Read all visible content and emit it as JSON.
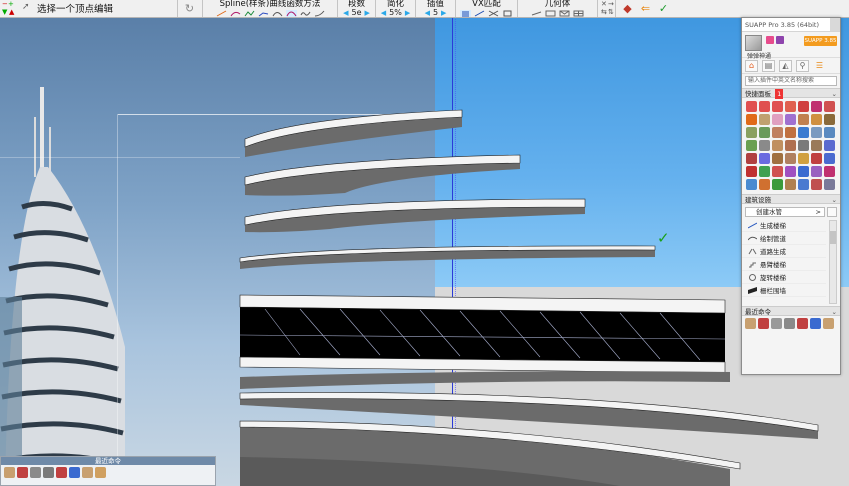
{
  "toolbar": {
    "status_hint": "选择一个顶点编辑",
    "spline_label": "Spline(样条)曲线函数方法",
    "segments_label": "段数",
    "segments_value": "5e",
    "simplify_label": "简化",
    "simplify_value": "5%",
    "interpolate_label": "插值",
    "interpolate_value": "5",
    "vx_label": "VX匹配",
    "geometry_label": "几何体"
  },
  "suapp": {
    "title": "SUAPP Pro 3.85 (64bit)",
    "username": "弹弹神通",
    "pro_button": "SUAPP 3.85",
    "search_placeholder": "输入插件中英文名称搜索",
    "quick_panel_label": "快捷面板",
    "quick_panel_badge": "1",
    "building_section_label": "建筑设施",
    "dropdown_value": "创建水管",
    "list_items": [
      {
        "label": "生成楼梯",
        "icon": "stair-icon"
      },
      {
        "label": "绘制管道",
        "icon": "pipe-icon"
      },
      {
        "label": "道路生成",
        "icon": "road-icon"
      },
      {
        "label": "悬臂楼梯",
        "icon": "cantilever-stair-icon"
      },
      {
        "label": "旋转楼梯",
        "icon": "spiral-stair-icon"
      },
      {
        "label": "栅栏围墙",
        "icon": "fence-icon"
      }
    ],
    "recent_label": "最近命令"
  },
  "mini_panel": {
    "label": "最近命令"
  },
  "colors": {
    "accent_orange": "#f39b1e",
    "sky_blue": "#3f97e0",
    "axis_blue": "#2b3bd8",
    "confirm_green": "#1aa01a"
  }
}
